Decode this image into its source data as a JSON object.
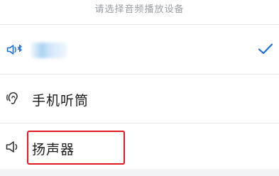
{
  "sheet": {
    "title": "请选择音频播放设备"
  },
  "devices": [
    {
      "id": "bluetooth",
      "label": "",
      "selected": true
    },
    {
      "id": "handset",
      "label": "手机听筒",
      "selected": false
    },
    {
      "id": "speaker",
      "label": "扬声器",
      "selected": false
    }
  ],
  "colors": {
    "accent": "#1a6ee0",
    "highlight": "#e0191b"
  },
  "icons": [
    "bluetooth-speaker-icon",
    "ear-handset-icon",
    "speaker-icon",
    "checkmark-icon"
  ]
}
